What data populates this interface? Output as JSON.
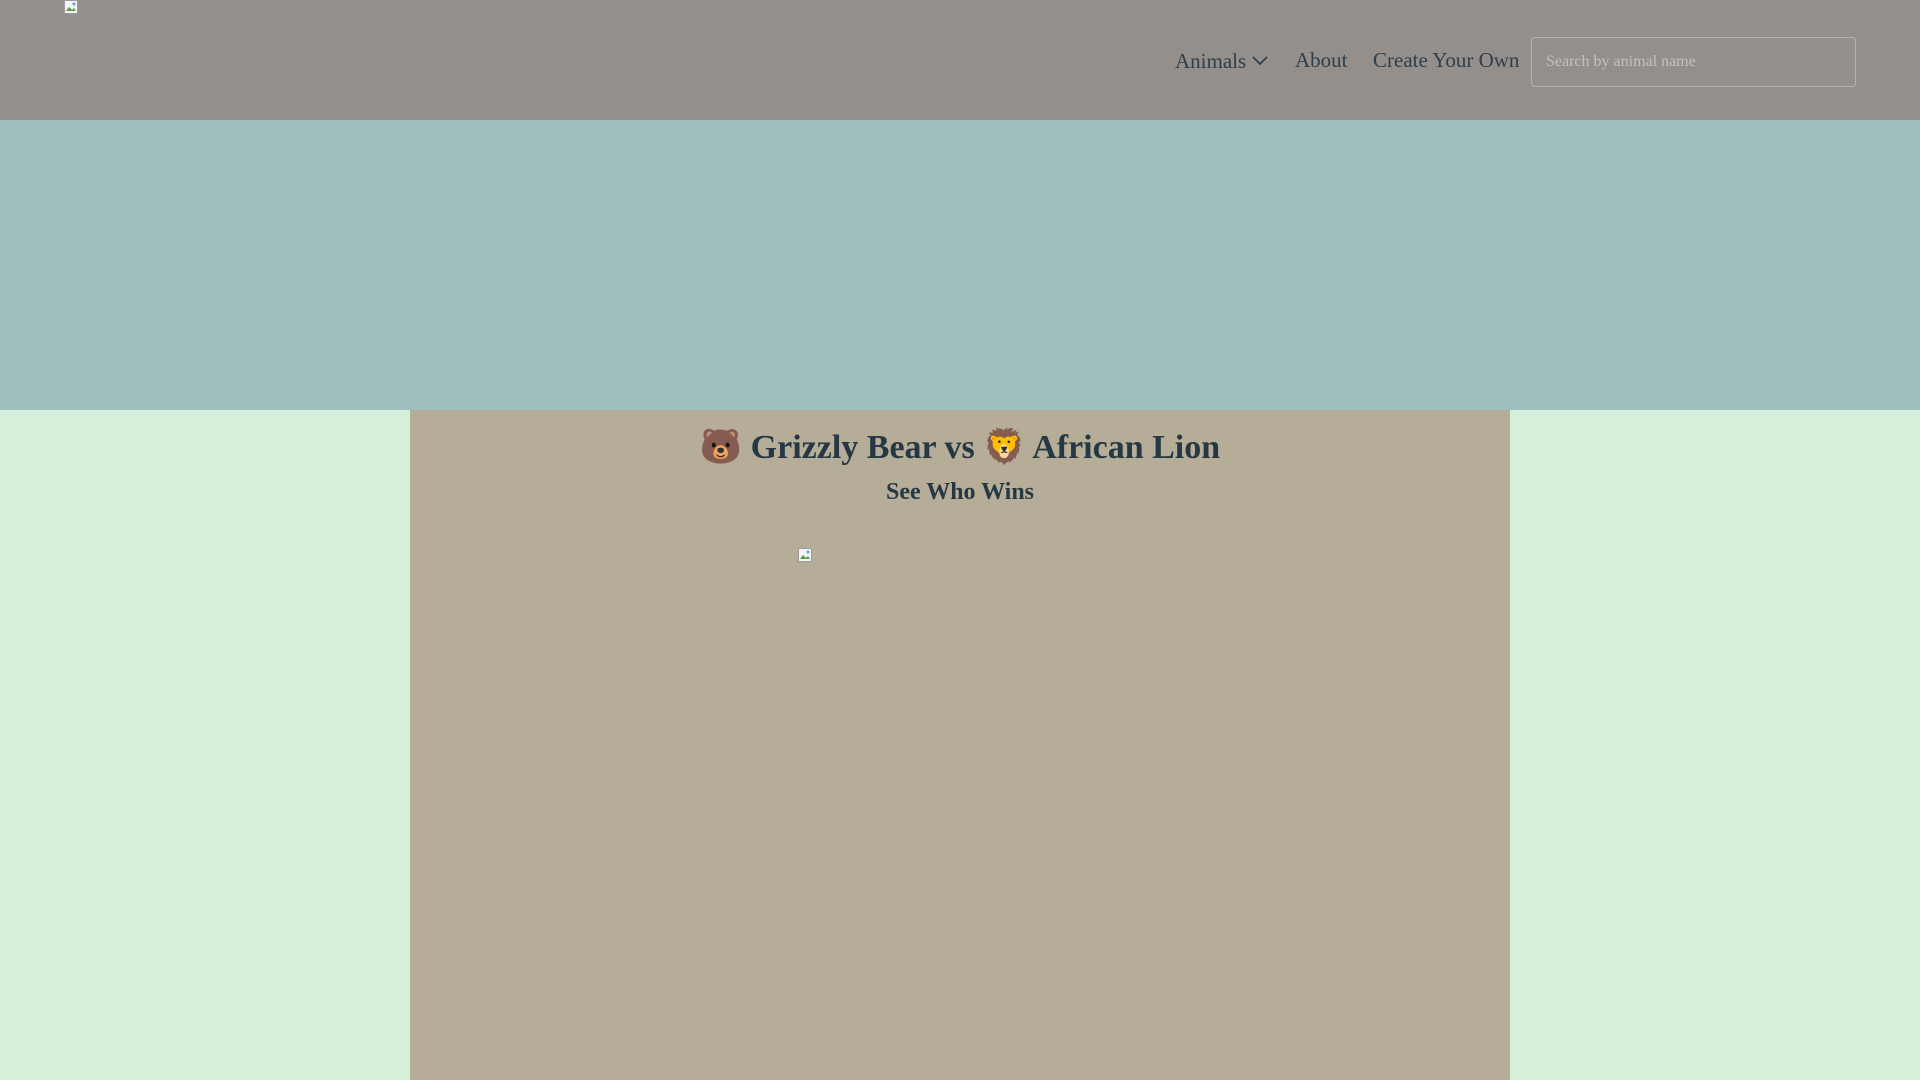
{
  "header": {
    "logo_icon": "broken-image-icon",
    "nav": {
      "animals_label": "Animals",
      "animals_icon": "chevron-down-icon",
      "about_label": "About",
      "create_label": "Create Your Own"
    },
    "search": {
      "placeholder": "Search by animal name",
      "value": ""
    }
  },
  "main": {
    "title": "🐻 Grizzly Bear vs 🦁 African Lion",
    "subtitle": "See Who Wins",
    "image_icon": "broken-image-icon"
  },
  "colors": {
    "page_background": "#d4f0da",
    "header_background": "#948f8b",
    "hero_background": "#a0bfbf",
    "card_background": "#b5ad97",
    "text": "#253844",
    "nav_text": "#2f3e4b"
  }
}
